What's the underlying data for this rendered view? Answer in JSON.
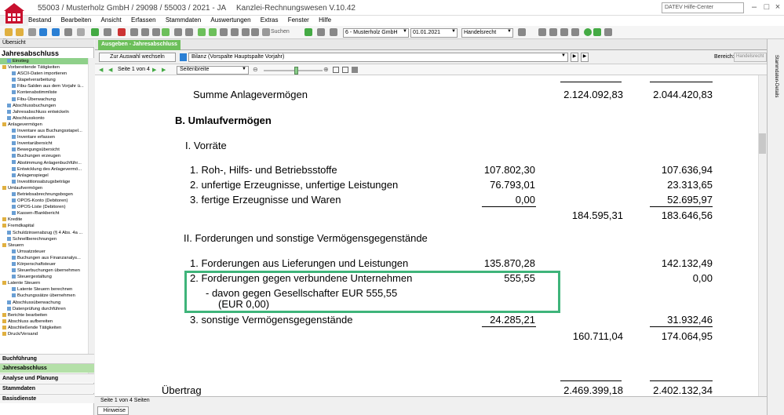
{
  "titlebar": {
    "title": "55003 / Musterholz GmbH / 29098 / 55003 / 2021 - JA",
    "app_name": "Kanzlei-Rechnungswesen V.10.42",
    "help_placeholder": "DATEV Hilfe-Center"
  },
  "menu": [
    "Bestand",
    "Bearbeiten",
    "Ansicht",
    "Erfassen",
    "Stammdaten",
    "Auswertungen",
    "Extras",
    "Fenster",
    "Hilfe"
  ],
  "toolbar": {
    "search_label": "Suchen",
    "client_combo": "6 - Musterholz GmbH",
    "date_combo": "01.01.2021",
    "law_combo": "Handelsrecht"
  },
  "left": {
    "header": "Übersicht",
    "title": "Jahresabschluss",
    "tree": [
      {
        "label": "Einstieg",
        "indent": 1,
        "sel": true
      },
      {
        "label": "Vorbereitende Tätigkeiten",
        "indent": 0
      },
      {
        "label": "ASCII-Daten importieren",
        "indent": 2
      },
      {
        "label": "Stapelverarbeitung",
        "indent": 2
      },
      {
        "label": "Fibu-Salden aus dem Vorjahr ü...",
        "indent": 2
      },
      {
        "label": "Kontenabstimmliste",
        "indent": 2
      },
      {
        "label": "Fibu-Überwachung",
        "indent": 2
      },
      {
        "label": "Abschlussbuchungen",
        "indent": 1
      },
      {
        "label": "Jahresabschluss entwickeln",
        "indent": 1
      },
      {
        "label": "Abschlusskonto",
        "indent": 1
      },
      {
        "label": "Anlagevermögen",
        "indent": 0
      },
      {
        "label": "Inventare aus Buchungsstapel...",
        "indent": 2
      },
      {
        "label": "Inventare erfassen",
        "indent": 2
      },
      {
        "label": "Inventarübersicht",
        "indent": 2
      },
      {
        "label": "Bewegungsübersicht",
        "indent": 2
      },
      {
        "label": "Buchungen erzeugen",
        "indent": 2
      },
      {
        "label": "Abstimmung Anlagenbuchführ...",
        "indent": 2
      },
      {
        "label": "Entwicklung des Anlagevermö...",
        "indent": 2
      },
      {
        "label": "Anlagenspiegel",
        "indent": 2
      },
      {
        "label": "Investitionsabzugsbeträge",
        "indent": 2
      },
      {
        "label": "Umlaufvermögen",
        "indent": 0
      },
      {
        "label": "Betriebsabrechnungsbogen",
        "indent": 2
      },
      {
        "label": "OPOS-Konto (Debitoren)",
        "indent": 2
      },
      {
        "label": "OPOS-Liste (Debitoren)",
        "indent": 2
      },
      {
        "label": "Kassen-/Bankbericht",
        "indent": 2
      },
      {
        "label": "Kredite",
        "indent": 0
      },
      {
        "label": "Fremdkapital",
        "indent": 0
      },
      {
        "label": "Schuldzinsenabzug (§ 4 Abs. 4a ...",
        "indent": 1
      },
      {
        "label": "Schnellberechnungen",
        "indent": 1
      },
      {
        "label": "Steuern",
        "indent": 0
      },
      {
        "label": "Umsatzsteuer",
        "indent": 2
      },
      {
        "label": "Buchungen aus Finanzanalys...",
        "indent": 2
      },
      {
        "label": "Körperschaftsteuer",
        "indent": 2
      },
      {
        "label": "Steuerbuchungen übernehmen",
        "indent": 2
      },
      {
        "label": "Steuergestaltung",
        "indent": 2
      },
      {
        "label": "Latente Steuern",
        "indent": 0
      },
      {
        "label": "Latente Steuern berechnen",
        "indent": 2
      },
      {
        "label": "Buchungssätze übernehmen",
        "indent": 2
      },
      {
        "label": "Abschlussüberwachung",
        "indent": 1
      },
      {
        "label": "Datenprüfung durchführen",
        "indent": 1
      },
      {
        "label": "Berichte bearbeiten",
        "indent": 0
      },
      {
        "label": "Abschluss aufbereiten",
        "indent": 0
      },
      {
        "label": "Abschließende Tätigkeiten",
        "indent": 0
      },
      {
        "label": "Druck/Versand",
        "indent": 0
      }
    ],
    "nav": [
      "Buchführung",
      "Jahresabschluss",
      "Analyse und Planung",
      "Stammdaten",
      "Basisdienste"
    ]
  },
  "main": {
    "tab": "Ausgeben - Jahresabschluss",
    "back_button": "Zur Auswahl wechseln",
    "report_combo": "Bilanz (Vorspalte Hauptspalte Vorjahr)",
    "bereich_label": "Bereich:",
    "bereich_value": "Handelsrecht",
    "page_info": "Seite 1 von 4",
    "zoom_combo": "Seitenbreite",
    "right_tab": "Stammdaten-Details"
  },
  "report": {
    "summe_anlage": {
      "label": "Summe Anlagevermögen",
      "cur": "2.124.092,83",
      "prev": "2.044.420,83"
    },
    "umlauf_head": "B.  Umlaufvermögen",
    "vorraete_head": "I.  Vorräte",
    "vorraete": [
      {
        "label": "1.   Roh-, Hilfs- und Betriebsstoffe",
        "sub": "107.802,30",
        "prev": "107.636,94"
      },
      {
        "label": "2.   unfertige Erzeugnisse, unfertige Leistungen",
        "sub": "76.793,01",
        "prev": "23.313,65"
      },
      {
        "label": "3.   fertige Erzeugnisse und Waren",
        "sub": "0,00",
        "prev": "52.695,97"
      }
    ],
    "vorraete_total": {
      "cur": "184.595,31",
      "prev": "183.646,56"
    },
    "ford_head": "II.  Forderungen und sonstige Vermögensgegenstände",
    "ford1": {
      "label": "1.   Forderungen aus Lieferungen und Leistungen",
      "sub": "135.870,28",
      "prev": "142.132,49"
    },
    "ford2": {
      "label": "2.   Forderungen gegen verbundene Unternehmen",
      "sub": "555,55",
      "prev": "0,00"
    },
    "ford2_note1": "-   davon gegen Gesellschafter EUR 555,55",
    "ford2_note2": "(EUR 0,00)",
    "ford3": {
      "label": "3.   sonstige Vermögensgegenstände",
      "sub": "24.285,21",
      "prev": "31.932,46"
    },
    "ford_total": {
      "cur": "160.711,04",
      "prev": "174.064,95"
    },
    "uebertrag": {
      "label": "Übertrag",
      "cur": "2.469.399,18",
      "prev": "2.402.132,34"
    }
  },
  "status": {
    "text": "Seite 1 von 4 Seiten",
    "hinweise": "Hinweise"
  },
  "colors": {
    "accent": "#6cbf5a",
    "highlight": "#3fb47a"
  }
}
